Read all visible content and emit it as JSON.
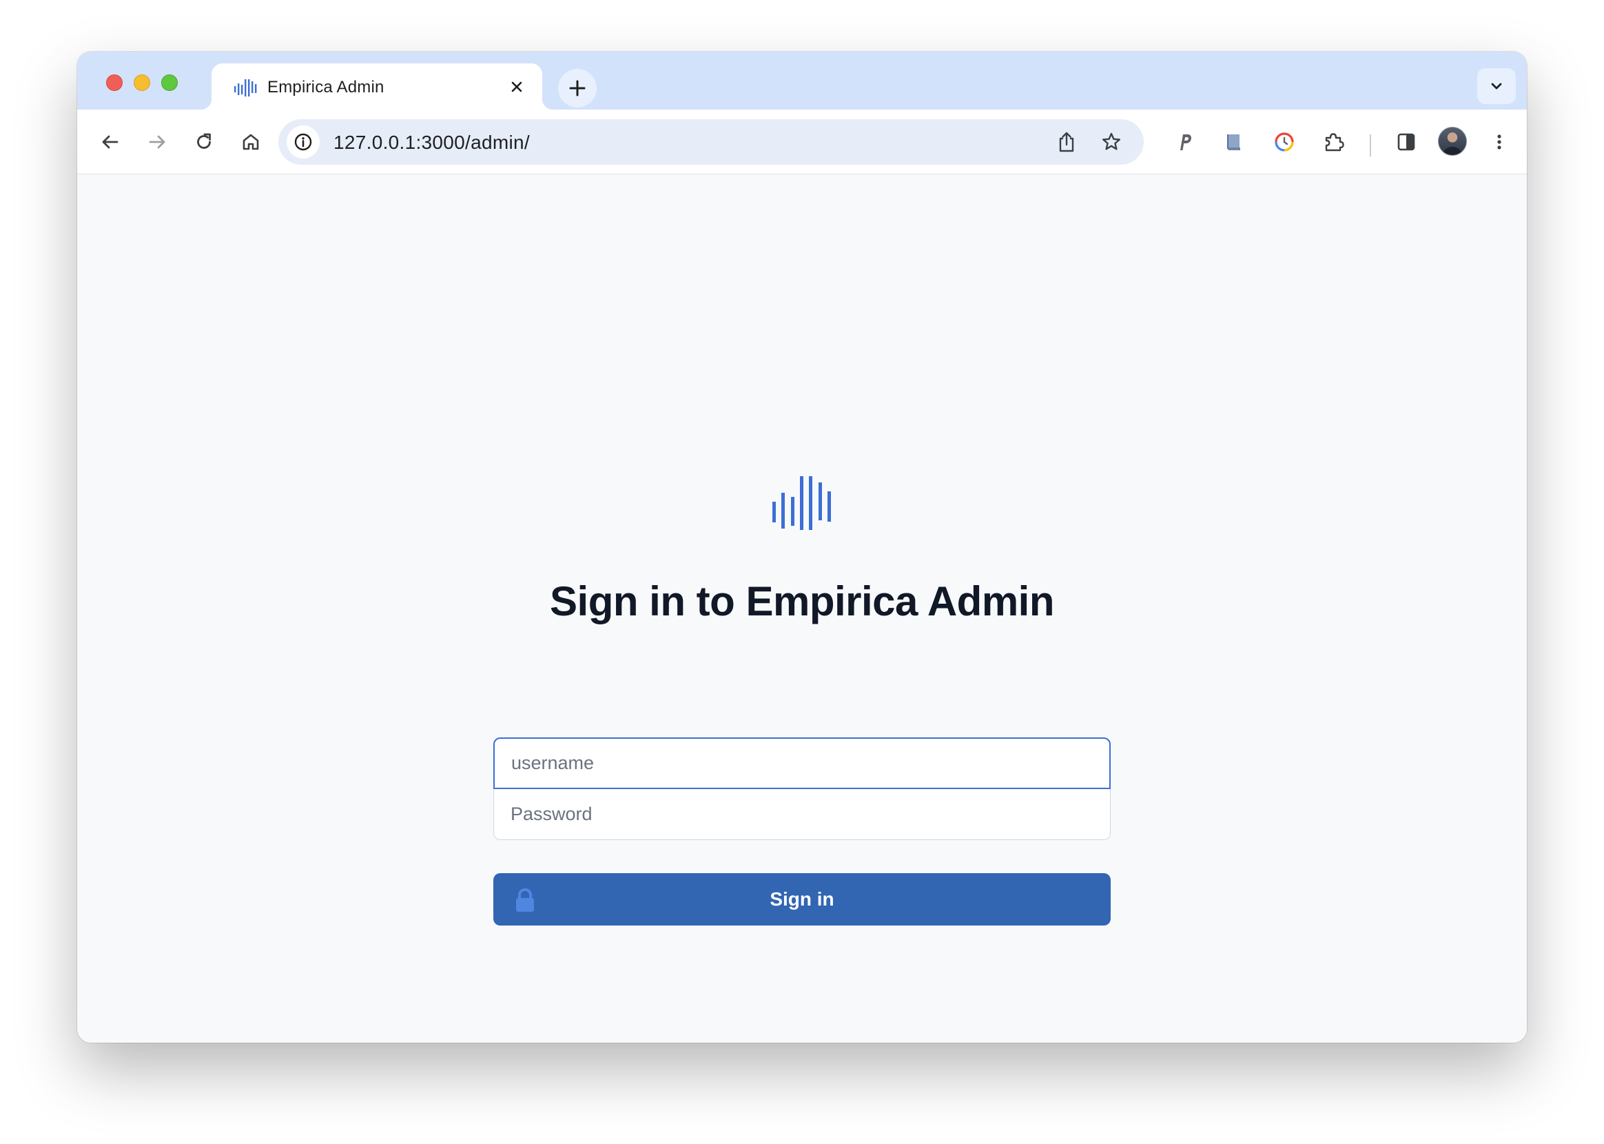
{
  "browser": {
    "tab": {
      "title": "Empirica Admin"
    },
    "address": {
      "url": "127.0.0.1:3000/admin/"
    },
    "icons": [
      "back-icon",
      "forward-icon",
      "reload-icon",
      "home-icon",
      "site-info-icon",
      "share-icon",
      "bookmark-star-icon",
      "extension-p-icon",
      "extension-book-icon",
      "extension-clock-icon",
      "extensions-puzzle-icon",
      "side-panel-icon",
      "profile-avatar",
      "menu-more-icon"
    ]
  },
  "login": {
    "heading": "Sign in to Empirica Admin",
    "username_placeholder": "username",
    "username_value": "",
    "password_placeholder": "Password",
    "password_value": "",
    "submit_label": "Sign in"
  },
  "colors": {
    "accent": "#3265b2",
    "logo": "#3b6fd4",
    "heading": "#111827",
    "page_background": "#f8f9fb",
    "tab_strip": "#d3e2fb"
  }
}
